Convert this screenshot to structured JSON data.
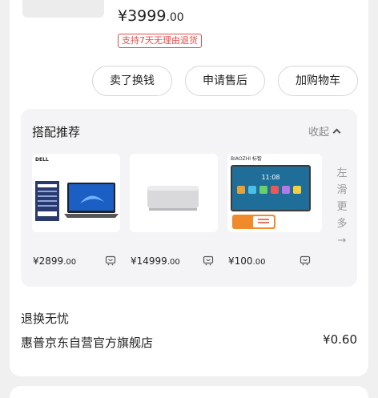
{
  "product": {
    "price_int": "¥3999",
    "price_dec": ".00",
    "return_badge": "支持7天无理由退货"
  },
  "actions": {
    "sell": "卖了换钱",
    "after_sale": "申请售后",
    "add_cart": "加购物车"
  },
  "recommend": {
    "title": "搭配推荐",
    "collapse_label": "收起",
    "more_label": [
      "左",
      "滑",
      "更",
      "多",
      "→"
    ],
    "items": [
      {
        "price_int": "¥2899",
        "price_dec": ".00",
        "brand": "DELL"
      },
      {
        "price_int": "¥14999",
        "price_dec": ".00",
        "brand": ""
      },
      {
        "price_int": "¥100",
        "price_dec": ".00",
        "brand": "BIAOZHI 标智",
        "screen_time": "11:08"
      }
    ]
  },
  "footer": {
    "worry_free": "退换无忧",
    "store_name": "惠普京东自营官方旗舰店",
    "shipping_fee": "¥0.60"
  },
  "colors": {
    "accent_red": "#e94a4a"
  }
}
